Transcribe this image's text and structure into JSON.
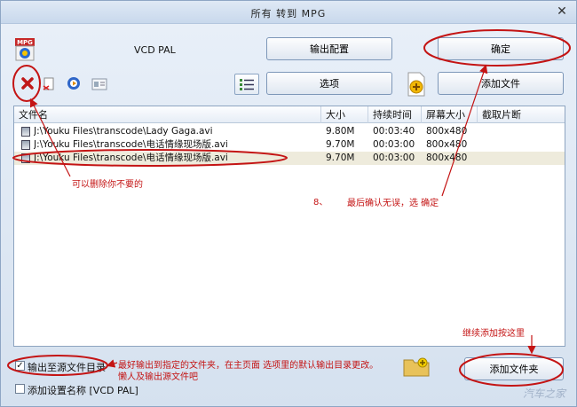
{
  "window": {
    "title": "所有 转到 MPG"
  },
  "profile": {
    "format_badge": "MPG",
    "name": "VCD PAL"
  },
  "buttons": {
    "output_config": "输出配置",
    "ok": "确定",
    "options": "选项",
    "add_file": "添加文件",
    "add_folder": "添加文件夹"
  },
  "table": {
    "headers": [
      "文件名",
      "大小",
      "持续时间",
      "屏幕大小",
      "截取片断"
    ],
    "rows": [
      {
        "name": "J:\\Youku Files\\transcode\\Lady Gaga.avi",
        "size": "9.80M",
        "duration": "00:03:40",
        "screen": "800x480",
        "clip": ""
      },
      {
        "name": "J:\\Youku Files\\transcode\\电话情缘现场版.avi",
        "size": "9.70M",
        "duration": "00:03:00",
        "screen": "800x480",
        "clip": ""
      },
      {
        "name": "J:\\Youku Files\\transcode\\电话情缘现场版.avi",
        "size": "9.70M",
        "duration": "00:03:00",
        "screen": "800x480",
        "clip": ""
      }
    ]
  },
  "bottom": {
    "output_to_source_label": "输出至源文件目录",
    "output_to_source_checked": true,
    "add_profile_name_label": "添加设置名称 [VCD PAL]",
    "add_profile_name_checked": false
  },
  "annotations": {
    "delete_hint": "可以删除你不要的",
    "confirm_step": "8、",
    "confirm_hint": "最后确认无误，选 确定",
    "add_more_hint": "继续添加按这里",
    "output_hint_line1": "最好输出到指定的文件夹，在主页面 选项里的默认输出目录更改。",
    "output_hint_line2": "懒人及输出源文件吧"
  },
  "colors": {
    "annotation": "#c41414",
    "selected_row": "#eeebdc"
  },
  "icons": [
    "close-icon",
    "mpg-profile-icon",
    "delete-icon",
    "clear-icon",
    "play-icon",
    "info-icon",
    "list-icon",
    "add-icon",
    "folder-icon",
    "file-icon"
  ],
  "watermark": "汽车之家"
}
